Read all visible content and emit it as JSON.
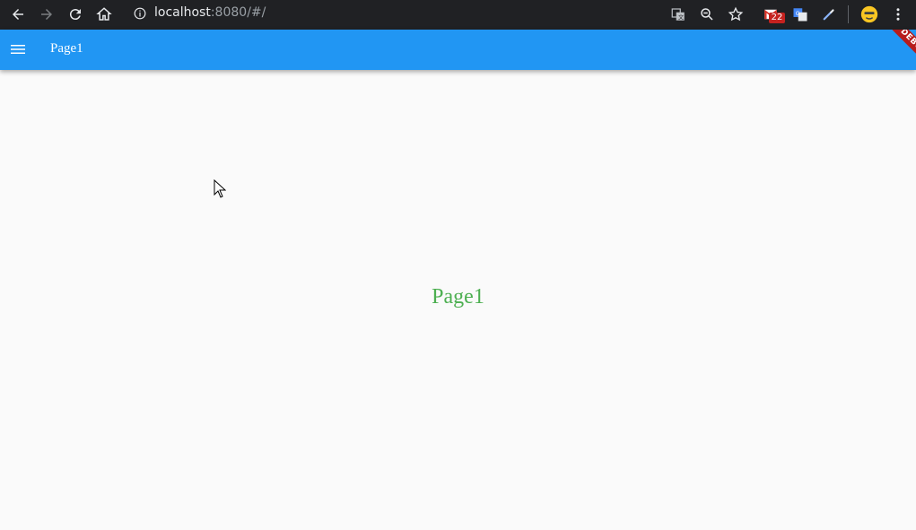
{
  "browser": {
    "url_host": "localhost",
    "url_rest": ":8080/#/",
    "extension_badge": "22",
    "colors": {
      "bar": "#202124",
      "icon": "#e8eaed",
      "dim": "#9aa0a6"
    }
  },
  "app_bar": {
    "title": "Page1",
    "menu_icon": "menu-icon",
    "debug_banner": "DEBUG",
    "color": "#2196f3"
  },
  "body": {
    "center_text": "Page1",
    "center_text_color": "#4caf50",
    "background": "#fafafa"
  }
}
